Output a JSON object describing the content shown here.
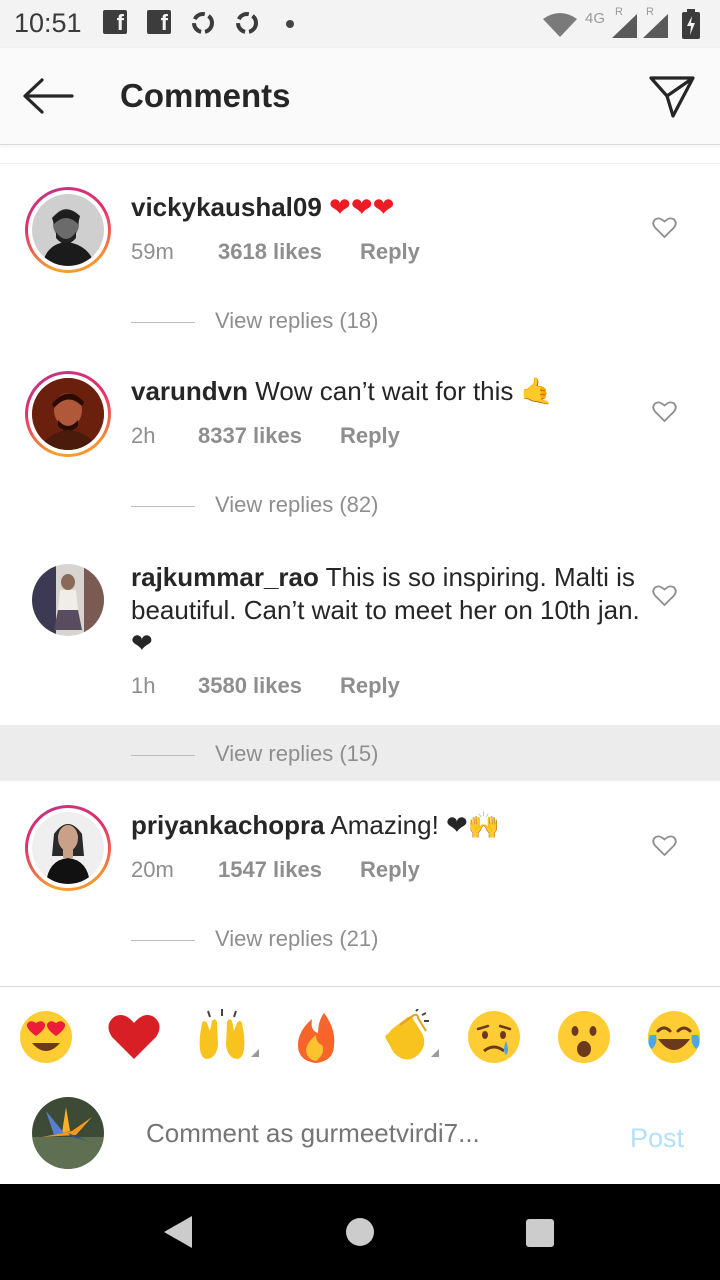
{
  "status_bar": {
    "time": "10:51",
    "network": "4G",
    "roaming_1": "R",
    "roaming_2": "R",
    "icons": [
      "facebook-icon",
      "facebook-icon",
      "recycle-icon",
      "recycle-icon",
      "dot-icon",
      "wifi-icon",
      "signal-icon",
      "signal-icon",
      "battery-icon"
    ]
  },
  "header": {
    "title": "Comments",
    "back_icon": "arrow-left-icon",
    "share_icon": "send-icon"
  },
  "comments": [
    {
      "username": "vickykaushal09",
      "text": " ❤❤❤",
      "time": "59m",
      "likes": "3618 likes",
      "reply": "Reply",
      "view_replies": "View replies (18)",
      "story_ring": true
    },
    {
      "username": "varundvn",
      "text": " Wow can’t wait for this 🤙",
      "time": "2h",
      "likes": "8337 likes",
      "reply": "Reply",
      "view_replies": "View replies (82)",
      "story_ring": true
    },
    {
      "username": "rajkummar_rao",
      "text": " This is so inspiring. Malti is beautiful. Can’t wait to meet her on 10th jan. ❤",
      "time": "1h",
      "likes": "3580 likes",
      "reply": "Reply",
      "view_replies": "View replies (15)",
      "story_ring": false
    },
    {
      "username": "priyankachopra",
      "text": " Amazing! ❤🙌",
      "time": "20m",
      "likes": "1547 likes",
      "reply": "Reply",
      "view_replies": "View replies (21)",
      "story_ring": true
    }
  ],
  "emoji_bar": [
    "😍",
    "❤️",
    "🙌",
    "🔥",
    "👏",
    "😢",
    "😮",
    "😂"
  ],
  "composer": {
    "placeholder": "Comment as gurmeetvirdi7...",
    "post_label": "Post"
  },
  "colors": {
    "accent_post": "#b2dffc",
    "heart": "#ed1c24",
    "meta_gray": "#8e8e8e"
  }
}
